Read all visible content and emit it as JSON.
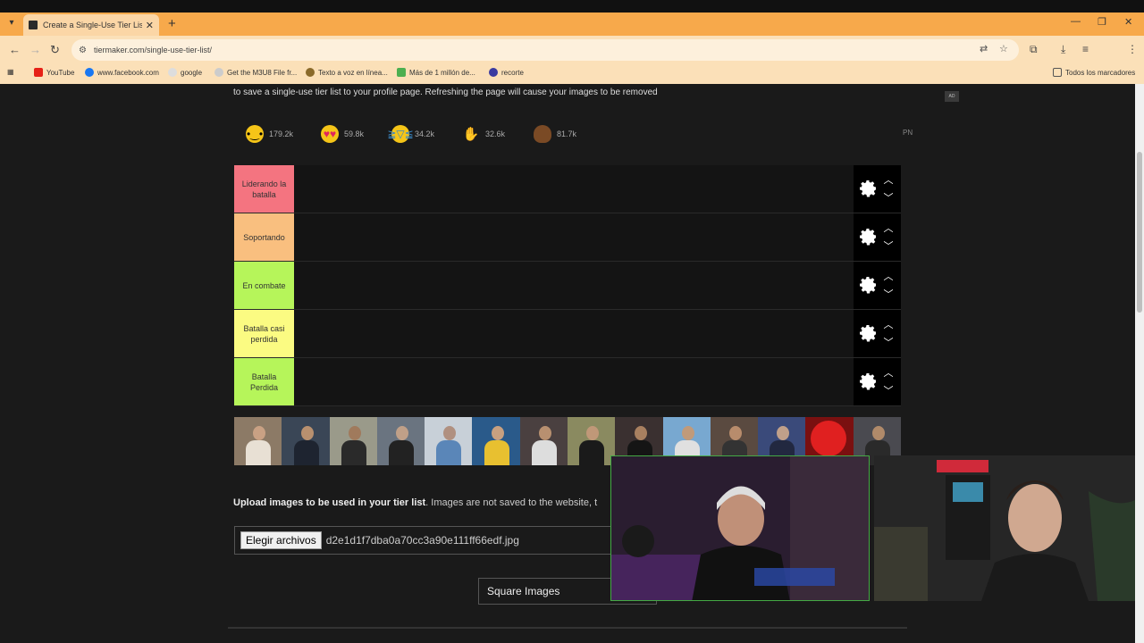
{
  "browser": {
    "tab_title": "Create a Single-Use Tier List (P...",
    "url": "tiermaker.com/single-use-tier-list/",
    "bookmarks": [
      "YouTube",
      "www.facebook.com",
      "google",
      "Get the M3U8 File fr...",
      "Texto a voz en línea...",
      "Más de 1 millón de...",
      "recorte"
    ],
    "all_bookmarks": "Todos los marcadores"
  },
  "page": {
    "intro": "to save a single-use tier list to your profile page. Refreshing the page will cause your images to be removed",
    "ad_label": "AD",
    "pn_label": "PN",
    "reactions": [
      {
        "icon": "grinning-face-icon",
        "count": "179.2k"
      },
      {
        "icon": "heart-eyes-icon",
        "count": "59.8k"
      },
      {
        "icon": "tears-of-joy-icon",
        "count": "34.2k"
      },
      {
        "icon": "raised-hands-icon",
        "count": "32.6k"
      },
      {
        "icon": "poop-icon",
        "count": "81.7k"
      }
    ],
    "tiers": [
      {
        "label": "Liderando la batalla",
        "color": "#f47480"
      },
      {
        "label": "Soportando",
        "color": "#f9bf7f"
      },
      {
        "label": "En combate",
        "color": "#b6f55a"
      },
      {
        "label": "Batalla casi perdida",
        "color": "#fbfb82"
      },
      {
        "label": "Batalla Perdida",
        "color": "#b6f55a"
      }
    ],
    "upload": {
      "heading": "Upload images to be used in your tier list",
      "note": ". Images are not saved to the website, t",
      "button": "Elegir archivos",
      "filename": "d2e1d1f7dba0a70cc3a90e111ff66edf.jpg"
    },
    "square_images": "Square Images"
  }
}
